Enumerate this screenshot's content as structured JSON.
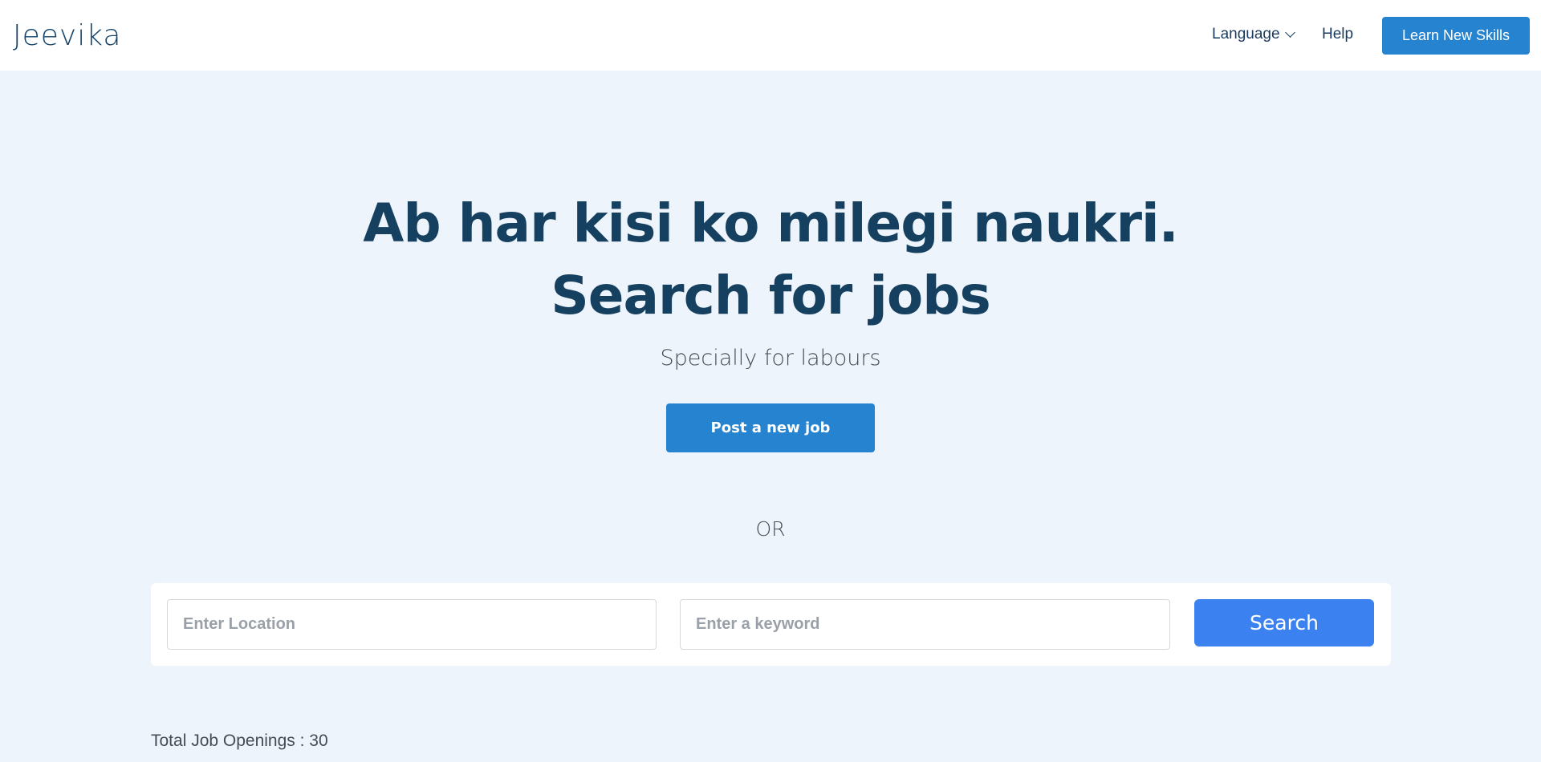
{
  "header": {
    "logo": "Jeevika",
    "language_label": "Language",
    "help_label": "Help",
    "skills_button": "Learn New Skills"
  },
  "hero": {
    "title_line1": "Ab har kisi ko milegi naukri.",
    "title_line2": "Search for jobs",
    "subtitle": "Specially for labours",
    "post_button": "Post a new job",
    "or_text": "OR"
  },
  "search": {
    "location_placeholder": "Enter Location",
    "keyword_placeholder": "Enter a keyword",
    "button_label": "Search"
  },
  "footer": {
    "total_openings": "Total Job Openings : 30"
  },
  "colors": {
    "brand": "#2683cf",
    "search_button": "#3b82f0",
    "heading": "#16405f",
    "background": "#eef4fc"
  },
  "icons": {
    "language_dropdown": "chevron-down-icon"
  }
}
